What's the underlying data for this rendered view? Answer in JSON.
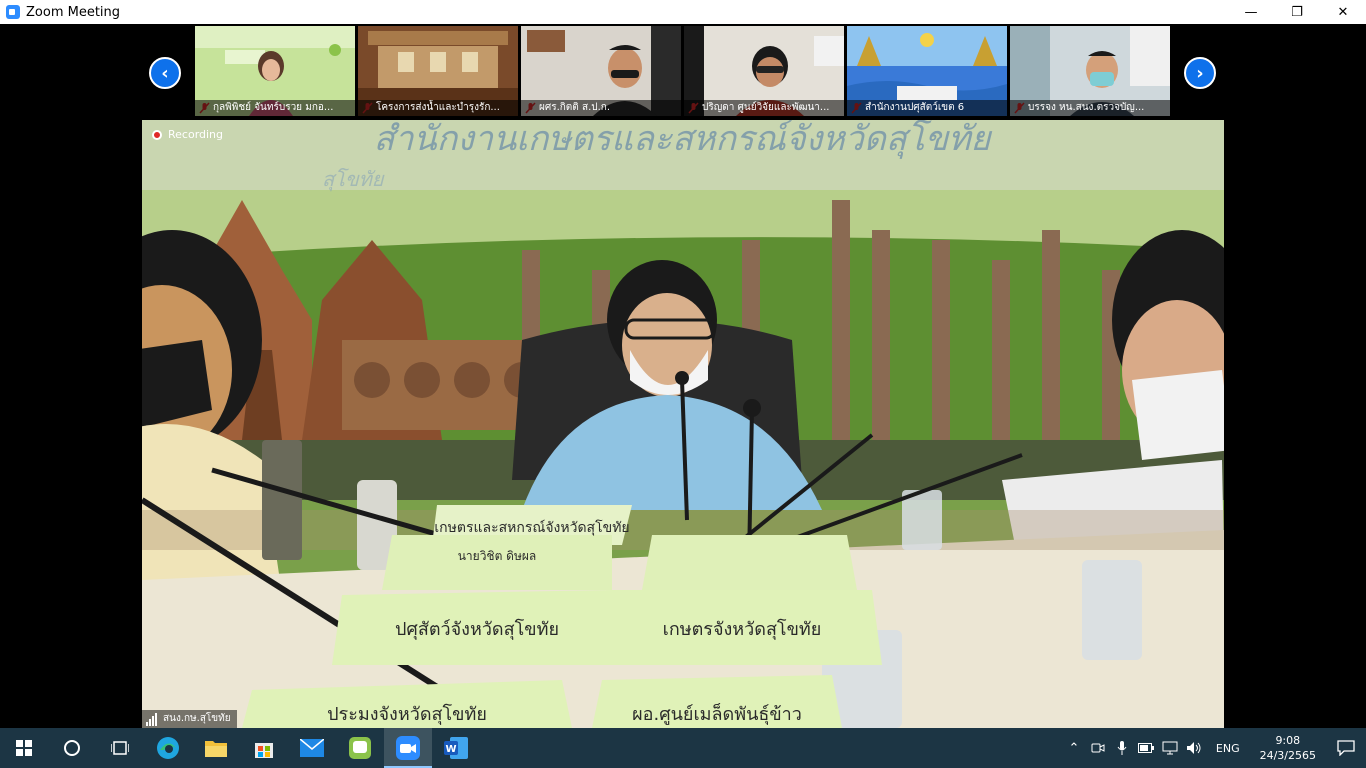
{
  "window": {
    "title": "Zoom Meeting",
    "controls": {
      "minimize": "—",
      "maximize": "❐",
      "close": "✕"
    }
  },
  "gallery": {
    "prev_icon": "chevron-left-icon",
    "next_icon": "chevron-right-icon",
    "participants": [
      {
        "name": "กุลพิพิชย์ จันทร์บรวย มกอ..."
      },
      {
        "name": "โครงการส่งน้ำและบำรุงรัก..."
      },
      {
        "name": "ผศร.กิตติ ส.ป.ก."
      },
      {
        "name": "ปริญดา ศูนย์วิจัยและพัฒนา..."
      },
      {
        "name": "สำนักงานปศุสัตว์เขต 6"
      },
      {
        "name": "บรรจง หน.สนง.ตรวจบัญ..."
      }
    ]
  },
  "main_video": {
    "recording_label": "Recording",
    "speaker_name": "สนง.กษ.สุโขทัย",
    "scene_signs": {
      "banner": "สำนักงานเกษตรและสหกรณ์จังหวัดสุโขทัย",
      "banner_sub": "สุโขทัย",
      "sign_chair": "เกษตรและสหกรณ์จังหวัดสุโขทัย",
      "sign_left_top": "นายวิชิต ดิษผล",
      "sign_left": "ปศุสัตว์จังหวัดสุโขทัย",
      "sign_center": "เกษตรจังหวัดสุโขทัย",
      "sign_bottom_left": "ประมงจังหวัดสุโขทัย",
      "sign_bottom_center": "ผอ.ศูนย์เมล็ดพันธุ์ข้าว"
    }
  },
  "taskbar": {
    "apps": [
      {
        "name": "start",
        "icon": "windows-icon"
      },
      {
        "name": "search",
        "icon": "search-circle-icon"
      },
      {
        "name": "task-view",
        "icon": "task-view-icon"
      },
      {
        "name": "edge",
        "icon": "edge-icon"
      },
      {
        "name": "file-explorer",
        "icon": "folder-icon"
      },
      {
        "name": "store",
        "icon": "store-icon"
      },
      {
        "name": "mail",
        "icon": "mail-icon"
      },
      {
        "name": "line",
        "icon": "line-icon"
      },
      {
        "name": "zoom",
        "icon": "zoom-icon"
      },
      {
        "name": "word",
        "icon": "word-icon"
      }
    ],
    "tray": {
      "language": "ENG",
      "time": "9:08",
      "date": "24/3/2565"
    }
  },
  "colors": {
    "zoom_blue": "#0e71eb",
    "recording_red": "#e02828",
    "taskbar_bg": "#1c3544",
    "mute_red": "#e02828"
  }
}
